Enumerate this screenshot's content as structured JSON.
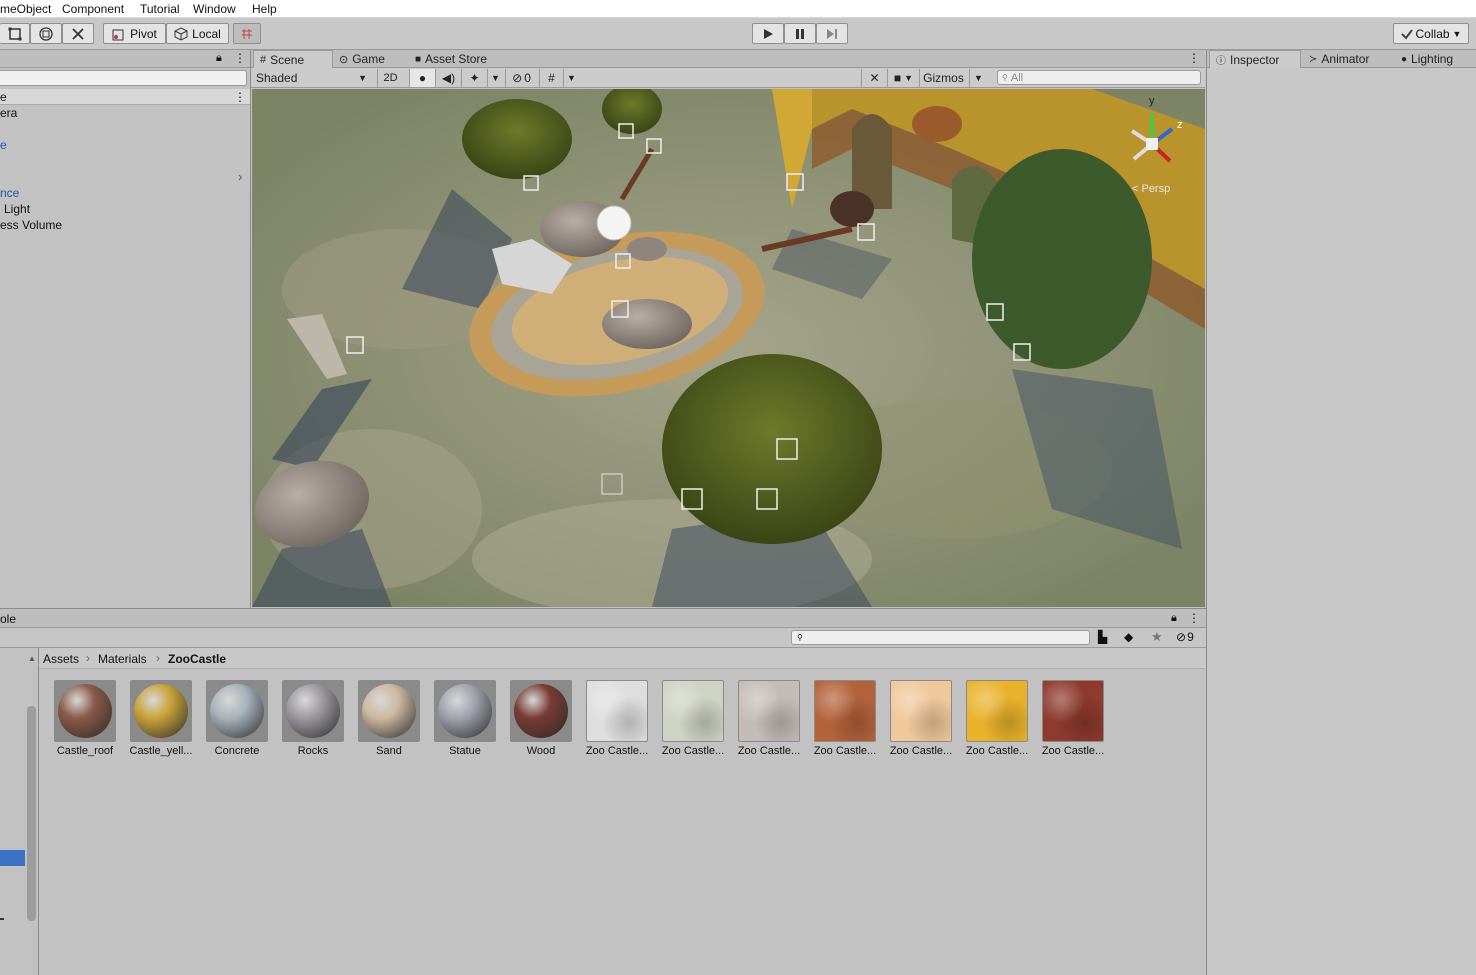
{
  "menu": [
    "meObject",
    "Component",
    "Tutorial",
    "Window",
    "Help"
  ],
  "toolbar": {
    "pivot_label": "Pivot",
    "local_label": "Local",
    "collab_label": "Collab"
  },
  "hierarchy": {
    "search_placeholder": "",
    "rows": [
      "e",
      "era",
      "",
      "e",
      "",
      "",
      "nce",
      "Light",
      "ess Volume"
    ]
  },
  "scene": {
    "tabs": [
      "Scene",
      "Game",
      "Asset Store"
    ],
    "shading_mode": "Shaded",
    "mode_2d": "2D",
    "hidden_count": "0",
    "gizmos_label": "Gizmos",
    "search_placeholder": "All",
    "persp_label": "< Persp",
    "axis": {
      "y": "y",
      "z": "z"
    }
  },
  "inspector": {
    "tabs": [
      "Inspector",
      "Animator",
      "Lighting"
    ]
  },
  "project": {
    "header_fragment": "ole",
    "search_placeholder": "",
    "hidden_count": "9",
    "breadcrumb": [
      "Assets",
      "Materials",
      "ZooCastle"
    ],
    "assets": [
      {
        "name": "Castle_roof",
        "kind": "sphere",
        "color": "#8a5a48"
      },
      {
        "name": "Castle_yell...",
        "kind": "sphere",
        "color": "#c9a238"
      },
      {
        "name": "Concrete",
        "kind": "sphere",
        "color": "#a9b3bb"
      },
      {
        "name": "Rocks",
        "kind": "sphere",
        "color": "#9c99a0"
      },
      {
        "name": "Sand",
        "kind": "sphere",
        "color": "#cdb8a0"
      },
      {
        "name": "Statue",
        "kind": "sphere",
        "color": "#a0a4ad"
      },
      {
        "name": "Wood",
        "kind": "sphere",
        "color": "#7a3b34"
      },
      {
        "name": "Zoo Castle...",
        "kind": "texture",
        "color": "#dedede"
      },
      {
        "name": "Zoo Castle...",
        "kind": "texture",
        "color": "#cfd3c3"
      },
      {
        "name": "Zoo Castle...",
        "kind": "texture",
        "color": "#c4bcb6"
      },
      {
        "name": "Zoo Castle...",
        "kind": "texture",
        "color": "#b3623a"
      },
      {
        "name": "Zoo Castle...",
        "kind": "texture",
        "color": "#f0c89a"
      },
      {
        "name": "Zoo Castle...",
        "kind": "texture",
        "color": "#e9b22a"
      },
      {
        "name": "Zoo Castle...",
        "kind": "texture",
        "color": "#8e3a2e"
      }
    ]
  },
  "colors": {
    "selection_blue": "#3a72c4",
    "link_blue": "#1f57b8"
  }
}
